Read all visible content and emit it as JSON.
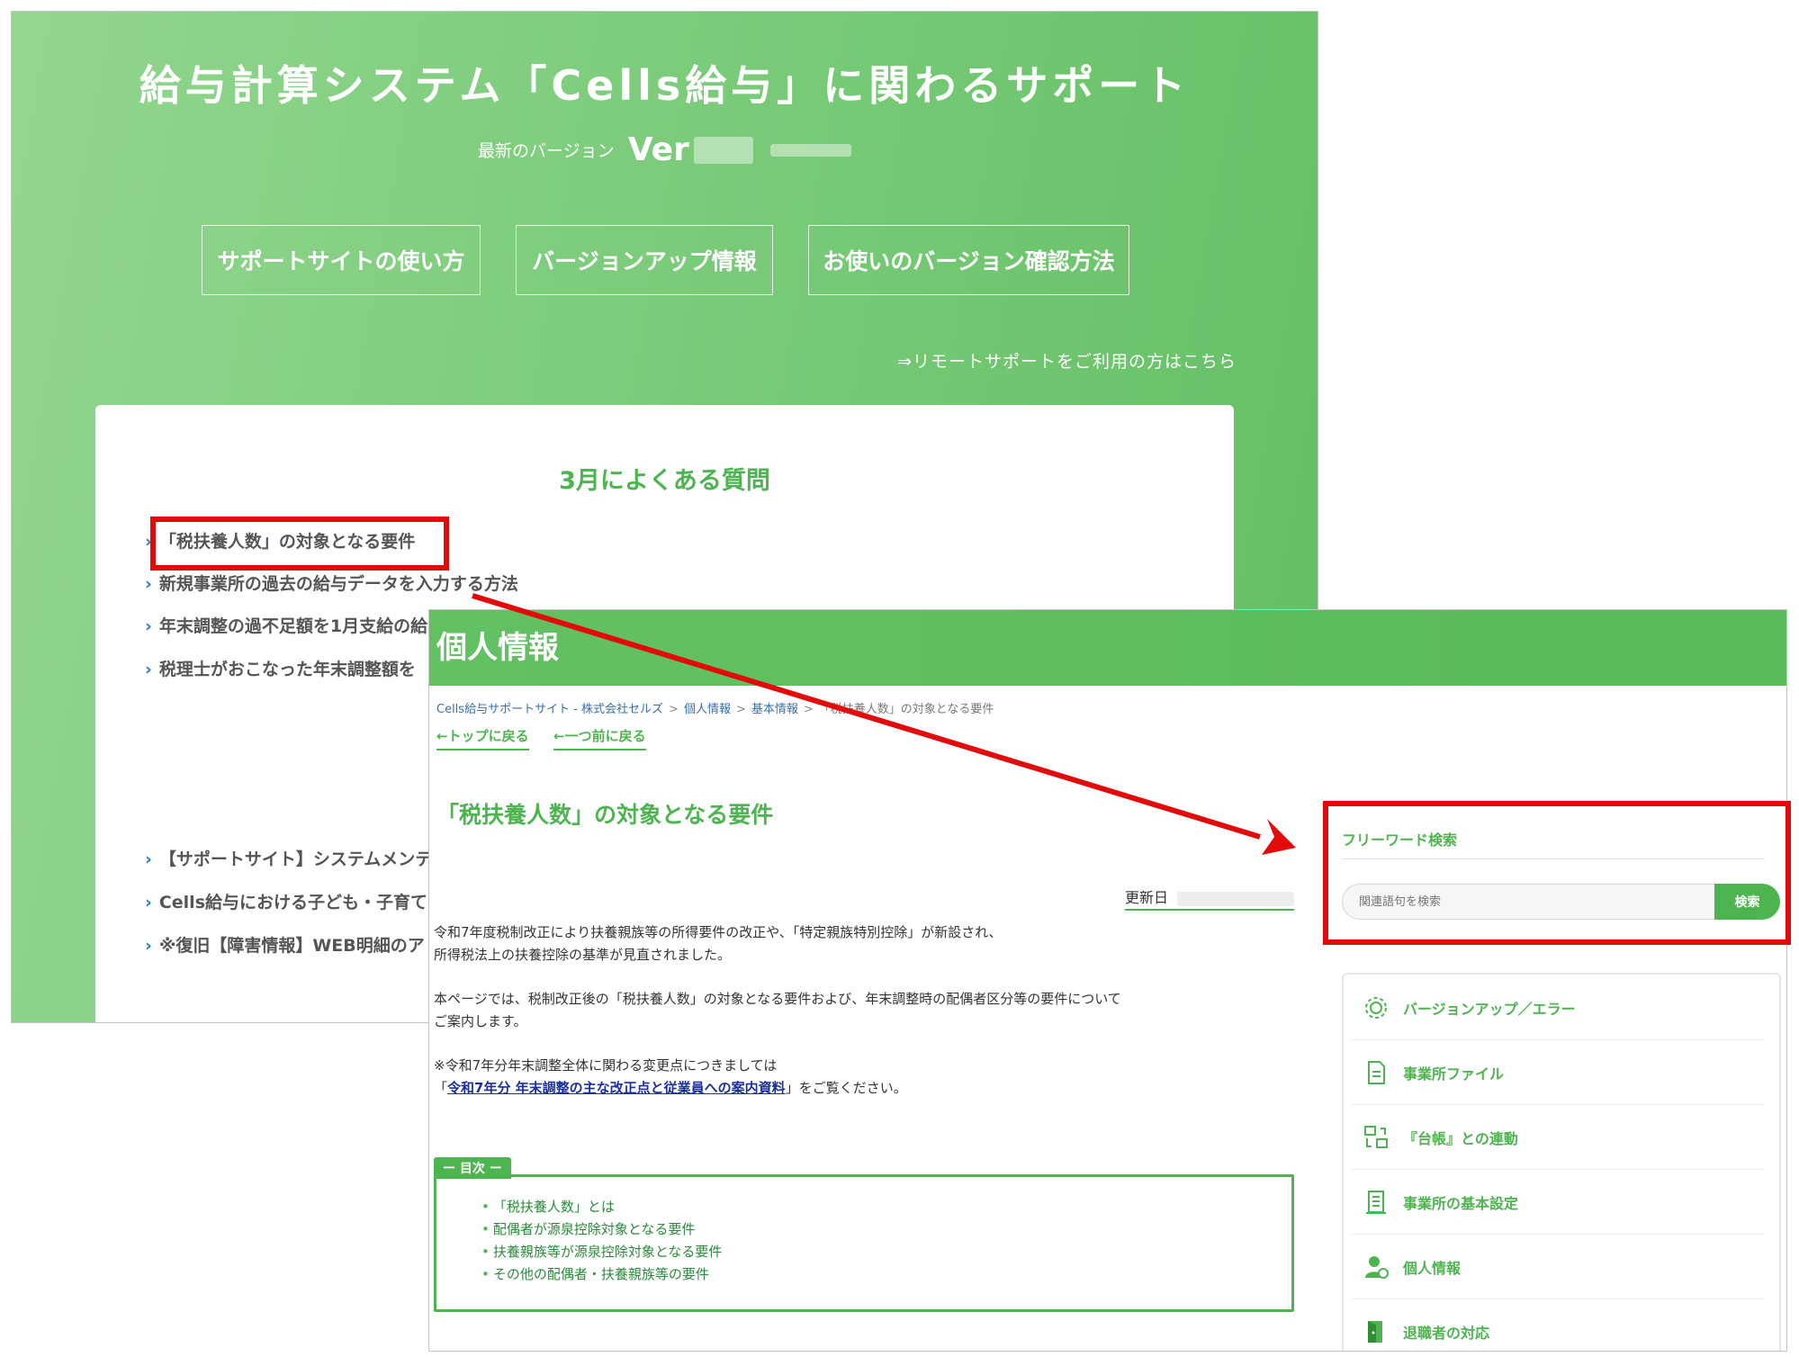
{
  "support_top": {
    "site_title": "給与計算システム「Cells給与」に関わるサポート",
    "version_label": "最新のバージョン",
    "version_value": "Ver",
    "buttons": [
      "サポートサイトの使い方",
      "バージョンアップ情報",
      "お使いのバージョン確認方法"
    ],
    "remote_support_link": "⇒リモートサポートをご利用の方はこちら",
    "faq_heading": "3月によくある質問",
    "faq_items": [
      "「税扶養人数」の対象となる要件",
      "新規事業所の過去の給与データを入力する方法",
      "年末調整の過不足額を1月支給の給",
      "税理士がおこなった年末調整額を"
    ],
    "notice_items": [
      "【サポートサイト】システムメンテ",
      "Cells給与における子ども・子育て",
      "※復旧【障害情報】WEB明細のア"
    ],
    "chevron": "›"
  },
  "personal_info_page": {
    "header_title": "個人情報",
    "breadcrumb": [
      "Cells給与サポートサイト - 株式会社セルズ",
      "個人情報",
      "基本情報",
      "「税扶養人数」の対象となる要件"
    ],
    "breadcrumb_separator": ">",
    "nav_top": "←トップに戻る",
    "nav_prev": "←一つ前に戻る",
    "article_title": "「税扶養人数」の対象となる要件",
    "updated_label": "更新日",
    "paragraph1_line1": "令和7年度税制改正により扶養親族等の所得要件の改正や、「特定親族特別控除」が新設され、",
    "paragraph1_line2": "所得税法上の扶養控除の基準が見直されました。",
    "paragraph2_line1": "本ページでは、税制改正後の「税扶養人数」の対象となる要件および、年末調整時の配偶者区分等の要件について",
    "paragraph2_line2": "ご案内します。",
    "paragraph3_line1": "※令和7年分年末調整全体に関わる変更点につきましては",
    "paragraph3_prefix": "「",
    "paragraph3_link": "令和7年分 年末調整の主な改正点と従業員への案内資料",
    "paragraph3_suffix": "」をご覧ください。",
    "toc_label": "ー 目次 ー",
    "toc_items": [
      "「税扶養人数」とは",
      "配偶者が源泉控除対象となる要件",
      "扶養親族等が源泉控除対象となる要件",
      "その他の配偶者・扶養親族等の要件"
    ],
    "toc_bullet": "•"
  },
  "sidebar": {
    "free_word_title": "フリーワード検索",
    "search_placeholder": "関連語句を検索",
    "search_button": "検索",
    "categories": [
      {
        "label": "バージョンアップ／エラー",
        "icon": "gear-icon"
      },
      {
        "label": "事業所ファイル",
        "icon": "document-icon"
      },
      {
        "label": "『台帳』との連動",
        "icon": "sync-icon"
      },
      {
        "label": "事業所の基本設定",
        "icon": "building-icon"
      },
      {
        "label": "個人情報",
        "icon": "person-icon"
      },
      {
        "label": "退職者の対応",
        "icon": "exit-door-icon"
      }
    ]
  },
  "colors": {
    "brand_green": "#4cb54f",
    "highlight_red": "#e30a0a",
    "link_blue": "#1a2fa0"
  }
}
